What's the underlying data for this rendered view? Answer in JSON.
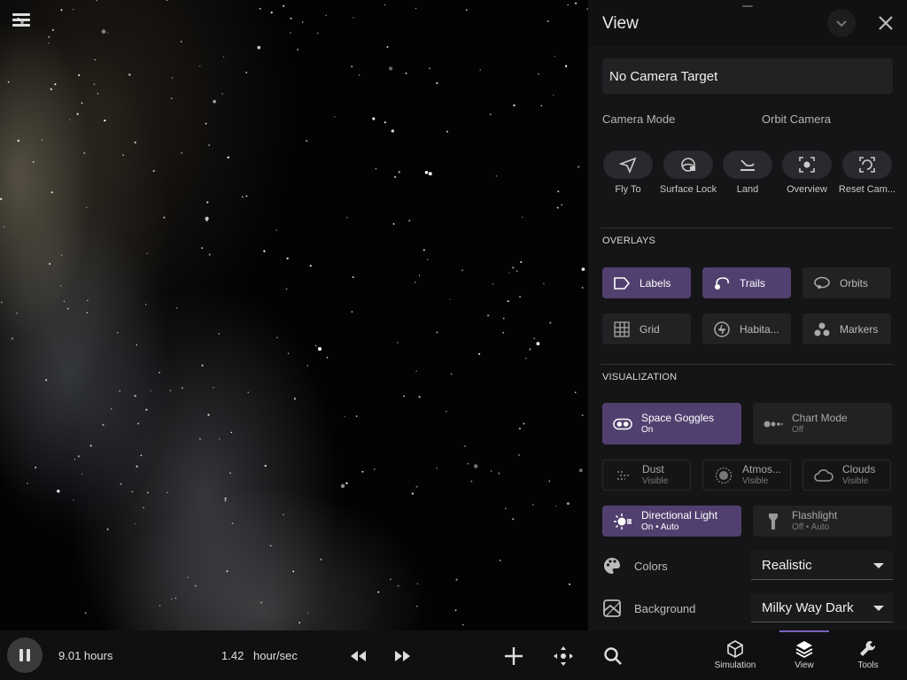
{
  "app": {
    "menu_icon": "hamburger-menu-icon"
  },
  "panel": {
    "title": "View",
    "camera_target": "No Camera Target",
    "camera_mode_label": "Camera Mode",
    "camera_mode_value": "Orbit Camera",
    "camera_buttons": [
      {
        "label": "Fly To",
        "icon": "paper-plane-icon"
      },
      {
        "label": "Surface Lock",
        "icon": "surface-lock-icon"
      },
      {
        "label": "Land",
        "icon": "landing-icon"
      },
      {
        "label": "Overview",
        "icon": "overview-icon"
      },
      {
        "label": "Reset Cam...",
        "icon": "reset-camera-icon"
      }
    ],
    "overlays_heading": "OVERLAYS",
    "overlays": [
      {
        "label": "Labels",
        "state": "on",
        "icon": "label-tag-icon"
      },
      {
        "label": "Trails",
        "state": "on",
        "icon": "trail-icon"
      },
      {
        "label": "Orbits",
        "state": "off",
        "icon": "orbit-icon"
      },
      {
        "label": "Grid",
        "state": "off",
        "icon": "grid-icon"
      },
      {
        "label": "Habita...",
        "state": "off",
        "icon": "habitable-zone-icon"
      },
      {
        "label": "Markers",
        "state": "off",
        "icon": "markers-icon"
      }
    ],
    "visualization_heading": "VISUALIZATION",
    "visualization": [
      {
        "title": "Space Goggles",
        "status": "On",
        "state": "on",
        "icon": "goggles-icon"
      },
      {
        "title": "Chart Mode",
        "status": "Off",
        "state": "off",
        "icon": "chart-mode-icon"
      },
      {
        "title": "Dust",
        "status": "Visible",
        "state": "off",
        "icon": "dust-icon"
      },
      {
        "title": "Atmos...",
        "status": "Visible",
        "state": "off",
        "icon": "atmosphere-icon"
      },
      {
        "title": "Clouds",
        "status": "Visible",
        "state": "off",
        "icon": "cloud-icon"
      },
      {
        "title": "Directional Light",
        "status": "On • Auto",
        "state": "on",
        "icon": "sun-light-icon"
      },
      {
        "title": "Flashlight",
        "status": "Off • Auto",
        "state": "off",
        "icon": "flashlight-icon"
      }
    ],
    "colors_label": "Colors",
    "colors_value": "Realistic",
    "background_label": "Background",
    "background_value": "Milky Way Dark"
  },
  "bottombar": {
    "elapsed": "9.01 hours",
    "rate_value": "1.42",
    "rate_unit": "hour/sec",
    "tabs": [
      {
        "label": "Simulation",
        "icon": "cube-icon"
      },
      {
        "label": "View",
        "icon": "layers-icon"
      },
      {
        "label": "Tools",
        "icon": "wrench-icon"
      }
    ]
  },
  "colors": {
    "accent_active": "#51406f",
    "panel_bg": "#151517",
    "tab_indicator": "#7b62b8"
  }
}
